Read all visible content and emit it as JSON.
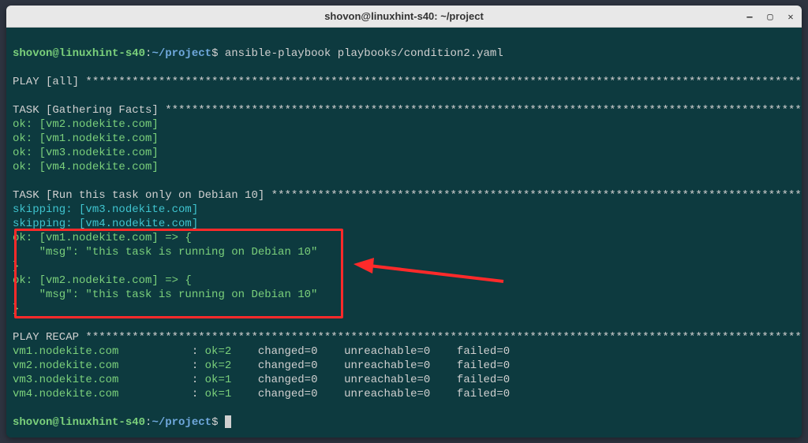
{
  "window_title": "shovon@linuxhint-s40: ~/project",
  "prompt": {
    "user_host": "shovon@linuxhint-s40",
    "path": "~/project",
    "sep1": ":",
    "sep2": "$"
  },
  "command": "ansible-playbook playbooks/condition2.yaml",
  "play_header": "PLAY [all]",
  "task1": {
    "header": "TASK [Gathering Facts]",
    "lines": [
      "ok: [vm2.nodekite.com]",
      "ok: [vm1.nodekite.com]",
      "ok: [vm3.nodekite.com]",
      "ok: [vm4.nodekite.com]"
    ]
  },
  "task2": {
    "header": "TASK [Run this task only on Debian 10]",
    "skipping": [
      "skipping: [vm3.nodekite.com]",
      "skipping: [vm4.nodekite.com]"
    ],
    "ok_results": [
      {
        "head": "ok: [vm1.nodekite.com] => {",
        "msg": "    \"msg\": \"this task is running on Debian 10\"",
        "close": "}"
      },
      {
        "head": "ok: [vm2.nodekite.com] => {",
        "msg": "    \"msg\": \"this task is running on Debian 10\"",
        "close": "}"
      }
    ]
  },
  "recap": {
    "header": "PLAY RECAP",
    "rows": [
      {
        "host": "vm1.nodekite.com",
        "ok": "ok=2",
        "changed": "changed=0",
        "unreachable": "unreachable=0",
        "failed": "failed=0"
      },
      {
        "host": "vm2.nodekite.com",
        "ok": "ok=2",
        "changed": "changed=0",
        "unreachable": "unreachable=0",
        "failed": "failed=0"
      },
      {
        "host": "vm3.nodekite.com",
        "ok": "ok=1",
        "changed": "changed=0",
        "unreachable": "unreachable=0",
        "failed": "failed=0"
      },
      {
        "host": "vm4.nodekite.com",
        "ok": "ok=1",
        "changed": "changed=0",
        "unreachable": "unreachable=0",
        "failed": "failed=0"
      }
    ]
  },
  "colors": {
    "bg": "#0d3a3f",
    "ok": "#7bd07b",
    "skip": "#3fc4cf",
    "highlight": "#ff2a2a"
  }
}
